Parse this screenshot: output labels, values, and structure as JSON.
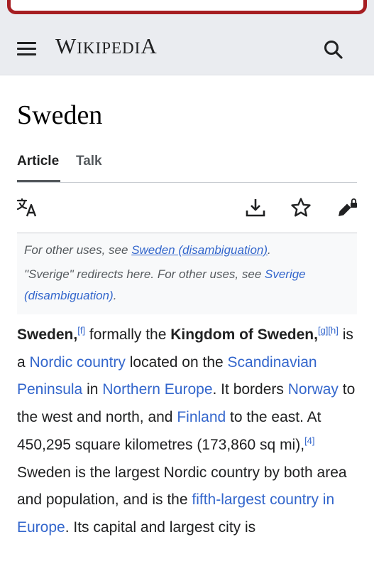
{
  "header": {
    "logo_first": "W",
    "logo_rest": "IKIPEDI",
    "logo_last": "A",
    "menu_icon": "hamburger-menu-icon",
    "search_icon": "search-icon"
  },
  "page": {
    "title": "Sweden",
    "tabs": [
      {
        "label": "Article",
        "active": true
      },
      {
        "label": "Talk",
        "active": false
      }
    ],
    "tools": [
      "language-icon",
      "download-icon",
      "watch-star-icon",
      "edit-lock-icon"
    ]
  },
  "hatnote": {
    "line1_prefix": "For other uses, see ",
    "line1_link": "Sweden (disambiguation)",
    "line1_suffix": ".",
    "line2_prefix": "\"Sverige\" redirects here. For other uses, see ",
    "line2_link": "Sverige (disambiguation)",
    "line2_suffix": "."
  },
  "article": {
    "s1": "Sweden",
    "s1_sup": "[f]",
    "s2": " formally the ",
    "s3": "Kingdom of Sweden",
    "s3_sup": "[g][h]",
    "s4": " is a ",
    "l_nordic": "Nordic country",
    "s5": " located on the ",
    "l_scand": "Scandinavian Peninsula",
    "s6": " in ",
    "l_neurope": "Northern Europe",
    "s7": ". It borders ",
    "l_norway": "Norway",
    "s8": " to the west and north, and ",
    "l_finland": "Finland",
    "s9": " to the east. At 450,295 square kilometres (173,860 sq mi),",
    "sup4": "[4]",
    "s10": " Sweden is the largest Nordic country by both area and population, and is the ",
    "l_fifth": "fifth-largest country in Europe",
    "s11": ". Its capital and largest city is"
  },
  "colors": {
    "link": "#3366cc",
    "header_bg": "#eaecf0",
    "banner_border": "#a61e22"
  }
}
